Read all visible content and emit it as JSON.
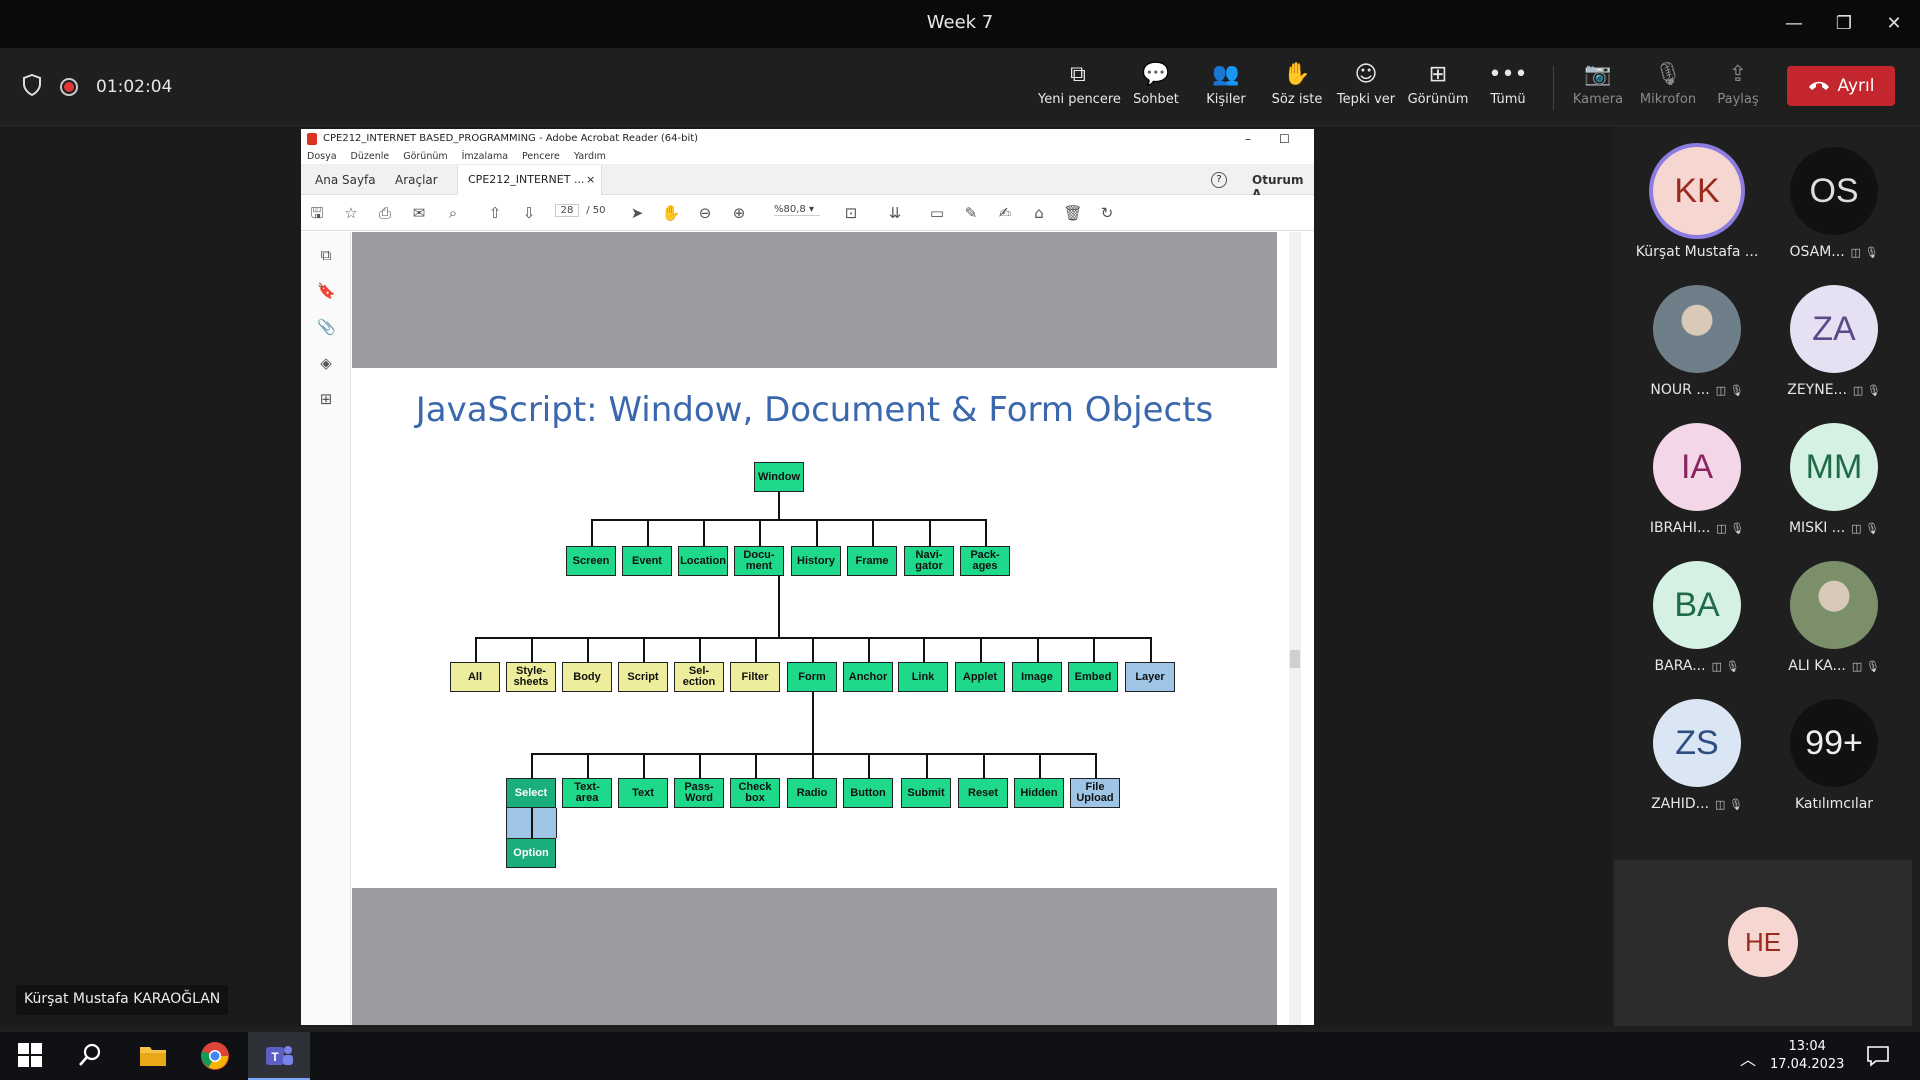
{
  "window": {
    "title": "Week 7"
  },
  "meeting": {
    "timer": "01:02:04",
    "toolbar": [
      {
        "label": "Yeni pencere",
        "icon": "popout-icon"
      },
      {
        "label": "Sohbet",
        "icon": "chat-icon"
      },
      {
        "label": "Kişiler",
        "icon": "people-icon"
      },
      {
        "label": "Söz iste",
        "icon": "raise-hand-icon"
      },
      {
        "label": "Tepki ver",
        "icon": "smiley-icon"
      },
      {
        "label": "Görünüm",
        "icon": "grid-icon"
      },
      {
        "label": "Tümü",
        "icon": "more-icon"
      },
      {
        "label": "Kamera",
        "icon": "camera-off-icon"
      },
      {
        "label": "Mikrofon",
        "icon": "mic-off-icon"
      },
      {
        "label": "Paylaş",
        "icon": "share-icon"
      }
    ],
    "leave_label": "Ayrıl",
    "presenter_name": "Kürşat Mustafa KARAOĞLAN"
  },
  "acrobat": {
    "title": "CPE212_INTERNET BASED_PROGRAMMING - Adobe Acrobat Reader (64-bit)",
    "menu": [
      "Dosya",
      "Düzenle",
      "Görünüm",
      "İmzalama",
      "Pencere",
      "Yardım"
    ],
    "tabs": {
      "home": "Ana Sayfa",
      "tools": "Araçlar",
      "doc": "CPE212_INTERNET ...",
      "signin": "Oturum A"
    },
    "page_current": "28",
    "page_total": "/ 50",
    "zoom": "%80,8"
  },
  "slide": {
    "title": "JavaScript: Window, Document & Form Objects",
    "root": "Window",
    "level1": [
      "Screen",
      "Event",
      "Location",
      "Docu-ment",
      "History",
      "Frame",
      "Navi-gator",
      "Pack-ages"
    ],
    "level2": [
      {
        "label": "All",
        "color": "yellow"
      },
      {
        "label": "Style-sheets",
        "color": "yellow"
      },
      {
        "label": "Body",
        "color": "yellow"
      },
      {
        "label": "Script",
        "color": "yellow"
      },
      {
        "label": "Sel-ection",
        "color": "yellow"
      },
      {
        "label": "Filter",
        "color": "yellow"
      },
      {
        "label": "Form",
        "color": "green"
      },
      {
        "label": "Anchor",
        "color": "green"
      },
      {
        "label": "Link",
        "color": "green"
      },
      {
        "label": "Applet",
        "color": "green"
      },
      {
        "label": "Image",
        "color": "green"
      },
      {
        "label": "Embed",
        "color": "green"
      },
      {
        "label": "Layer",
        "color": "blue"
      }
    ],
    "level3": [
      {
        "label": "Select",
        "color": "teal"
      },
      {
        "label": "Text-area",
        "color": "green"
      },
      {
        "label": "Text",
        "color": "green"
      },
      {
        "label": "Pass-Word",
        "color": "green"
      },
      {
        "label": "Check box",
        "color": "green"
      },
      {
        "label": "Radio",
        "color": "green"
      },
      {
        "label": "Button",
        "color": "green"
      },
      {
        "label": "Submit",
        "color": "green"
      },
      {
        "label": "Reset",
        "color": "green"
      },
      {
        "label": "Hidden",
        "color": "green"
      },
      {
        "label": "File Upload",
        "color": "blue"
      }
    ],
    "level4": "Option"
  },
  "participants": [
    {
      "initials": "KK",
      "name": "Kürşat Mustafa ...",
      "bg": "#f5d6d0",
      "fg": "#9b2a1e",
      "ring": true,
      "status": ""
    },
    {
      "initials": "OS",
      "name": "OSAM...",
      "bg": "#111111",
      "fg": "#dddddd",
      "ring": false,
      "status": "◫ 🎙"
    },
    {
      "initials": "",
      "name": "NOUR ...",
      "bg": "#6e7f8a",
      "fg": "#fff",
      "ring": false,
      "status": "◫ 🎙",
      "photo": true
    },
    {
      "initials": "ZA",
      "name": "ZEYNE...",
      "bg": "#e6e1f2",
      "fg": "#5b4a8a",
      "ring": false,
      "status": "◫ 🎙"
    },
    {
      "initials": "IA",
      "name": "IBRAHI...",
      "bg": "#f3d6e8",
      "fg": "#8a2561",
      "ring": false,
      "status": "◫ 🎙"
    },
    {
      "initials": "MM",
      "name": "MISKI ...",
      "bg": "#d4f1e3",
      "fg": "#1f6b48",
      "ring": false,
      "status": "◫ 🎙"
    },
    {
      "initials": "BA",
      "name": "BARA...",
      "bg": "#d4f1e3",
      "fg": "#1f6b48",
      "ring": false,
      "status": "◫ 🎙"
    },
    {
      "initials": "",
      "name": "ALI KA...",
      "bg": "#7a8f6a",
      "fg": "#fff",
      "ring": false,
      "status": "◫ 🎙",
      "photo": true
    },
    {
      "initials": "ZS",
      "name": "ZAHID...",
      "bg": "#dbe6f4",
      "fg": "#2d4e80",
      "ring": false,
      "status": "◫ 🎙"
    },
    {
      "initials": "99+",
      "name": "Katılımcılar",
      "bg": "#111111",
      "fg": "#eeeeee",
      "ring": false,
      "status": ""
    }
  ],
  "extra_tile": {
    "initials": "HE"
  },
  "taskbar": {
    "time": "13:04",
    "date": "17.04.2023"
  }
}
